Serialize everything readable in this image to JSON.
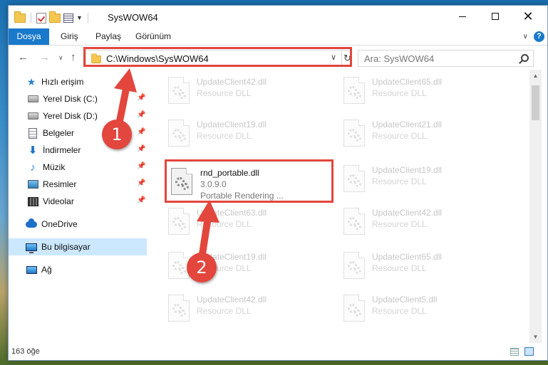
{
  "window": {
    "title": "SysWOW64",
    "accent": "#1979ca"
  },
  "ribbon": {
    "tabs": [
      "Dosya",
      "Giriş",
      "Paylaş",
      "Görünüm"
    ],
    "help": "?"
  },
  "nav": {
    "address": "C:\\Windows\\SysWOW64",
    "search_placeholder": "Ara: SysWOW64"
  },
  "sidebar": {
    "items": [
      {
        "label": "Hızlı erişim",
        "icon": "star-icon"
      },
      {
        "label": "Yerel Disk (C:)",
        "icon": "drive-icon"
      },
      {
        "label": "Yerel Disk (D:)",
        "icon": "drive-icon"
      },
      {
        "label": "Belgeler",
        "icon": "document-icon"
      },
      {
        "label": "İndirmeler",
        "icon": "download-icon"
      },
      {
        "label": "Müzik",
        "icon": "music-icon"
      },
      {
        "label": "Resimler",
        "icon": "pictures-icon"
      },
      {
        "label": "Videolar",
        "icon": "video-icon"
      },
      {
        "label": "OneDrive",
        "icon": "cloud-icon"
      },
      {
        "label": "Bu bilgisayar",
        "icon": "computer-icon"
      },
      {
        "label": "Ağ",
        "icon": "network-icon"
      }
    ]
  },
  "files": [
    {
      "name": "UpdateClient42.dll",
      "desc": "Resource DLL"
    },
    {
      "name": "UpdateClient65.dll",
      "desc": "Resource DLL"
    },
    {
      "name": "UpdateClient19.dll",
      "desc": "Resource DLL"
    },
    {
      "name": "UpdateClient21.dll",
      "desc": "Resource DLL"
    },
    {
      "name": "rnd_portable.dll",
      "version": "3.0.9.0",
      "desc": "Portable Rendering ..."
    },
    {
      "name": "UpdateClient19.dll",
      "desc": "Resource DLL"
    },
    {
      "name": "UpdateClient63.dll",
      "desc": "Resource DLL"
    },
    {
      "name": "UpdateClient42.dll",
      "desc": "Resource DLL"
    },
    {
      "name": "UpdateClient19.dll",
      "desc": "Resource DLL"
    },
    {
      "name": "UpdateClient65.dll",
      "desc": "Resource DLL"
    },
    {
      "name": "UpdateClient42.dll",
      "desc": "Resource DLL"
    },
    {
      "name": "UpdateClient5.dll",
      "desc": "Resource DLL"
    }
  ],
  "status": {
    "count": "163 öğe"
  },
  "annotations": {
    "marker1": "1",
    "marker2": "2",
    "color": "#e2463d"
  }
}
